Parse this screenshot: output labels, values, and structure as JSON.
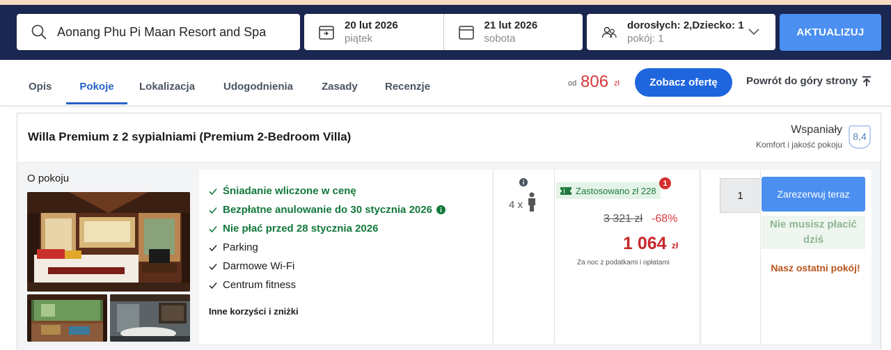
{
  "search": {
    "destination": "Aonang Phu Pi Maan Resort and Spa",
    "checkin_date": "20 lut 2026",
    "checkin_day": "piątek",
    "checkout_date": "21 lut 2026",
    "checkout_day": "sobota",
    "guests": "dorosłych: 2,Dziecko: 1",
    "rooms": "pokój: 1",
    "update_label": "AKTUALIZUJ"
  },
  "tabs": [
    {
      "label": "Opis"
    },
    {
      "label": "Pokoje",
      "active": true
    },
    {
      "label": "Lokalizacja"
    },
    {
      "label": "Udogodnienia"
    },
    {
      "label": "Zasady"
    },
    {
      "label": "Recenzje"
    }
  ],
  "header_price": {
    "from": "od",
    "value": "806",
    "currency": "zł"
  },
  "offer_button": "Zobacz ofertę",
  "back_to_top": "Powrót do góry strony",
  "room": {
    "title": "Willa Premium z 2 sypialniami (Premium 2-Bedroom Villa)",
    "rating_word": "Wspaniały",
    "rating_sub": "Komfort i jakość pokoju",
    "rating_score": "8,4",
    "about_label": "O pokoju",
    "benefits": [
      {
        "text": "Śniadanie wliczone w cenę",
        "highlight": true
      },
      {
        "text": "Bezpłatne anulowanie do 30 stycznia 2026",
        "highlight": true,
        "info": true
      },
      {
        "text": "Nie płać przed 28 stycznia 2026",
        "highlight": true
      },
      {
        "text": "Parking",
        "highlight": false
      },
      {
        "text": "Darmowe Wi-Fi",
        "highlight": false
      },
      {
        "text": "Centrum fitness",
        "highlight": false
      }
    ],
    "more_benefits": "Inne korzyści i zniżki",
    "occupancy": "4 x",
    "coupon": "Zastosowano zł 228",
    "coupon_badge": "1",
    "old_price": "3 321 zł",
    "discount": "-68%",
    "price": "1 064",
    "price_currency": "zł",
    "per_night": "Za noc z podatkami i opłatami",
    "quantity": "1",
    "book_label": "Zarezerwuj teraz",
    "no_pay_today": "Nie musisz płacić dziś",
    "last_room": "Nasz ostatni pokój!"
  },
  "colors": {
    "navy": "#1a2750",
    "accent_blue": "#4b8ff0",
    "button_blue": "#1f66de",
    "price_red": "#d6393c",
    "green": "#12783b",
    "orange": "#b8541a"
  }
}
